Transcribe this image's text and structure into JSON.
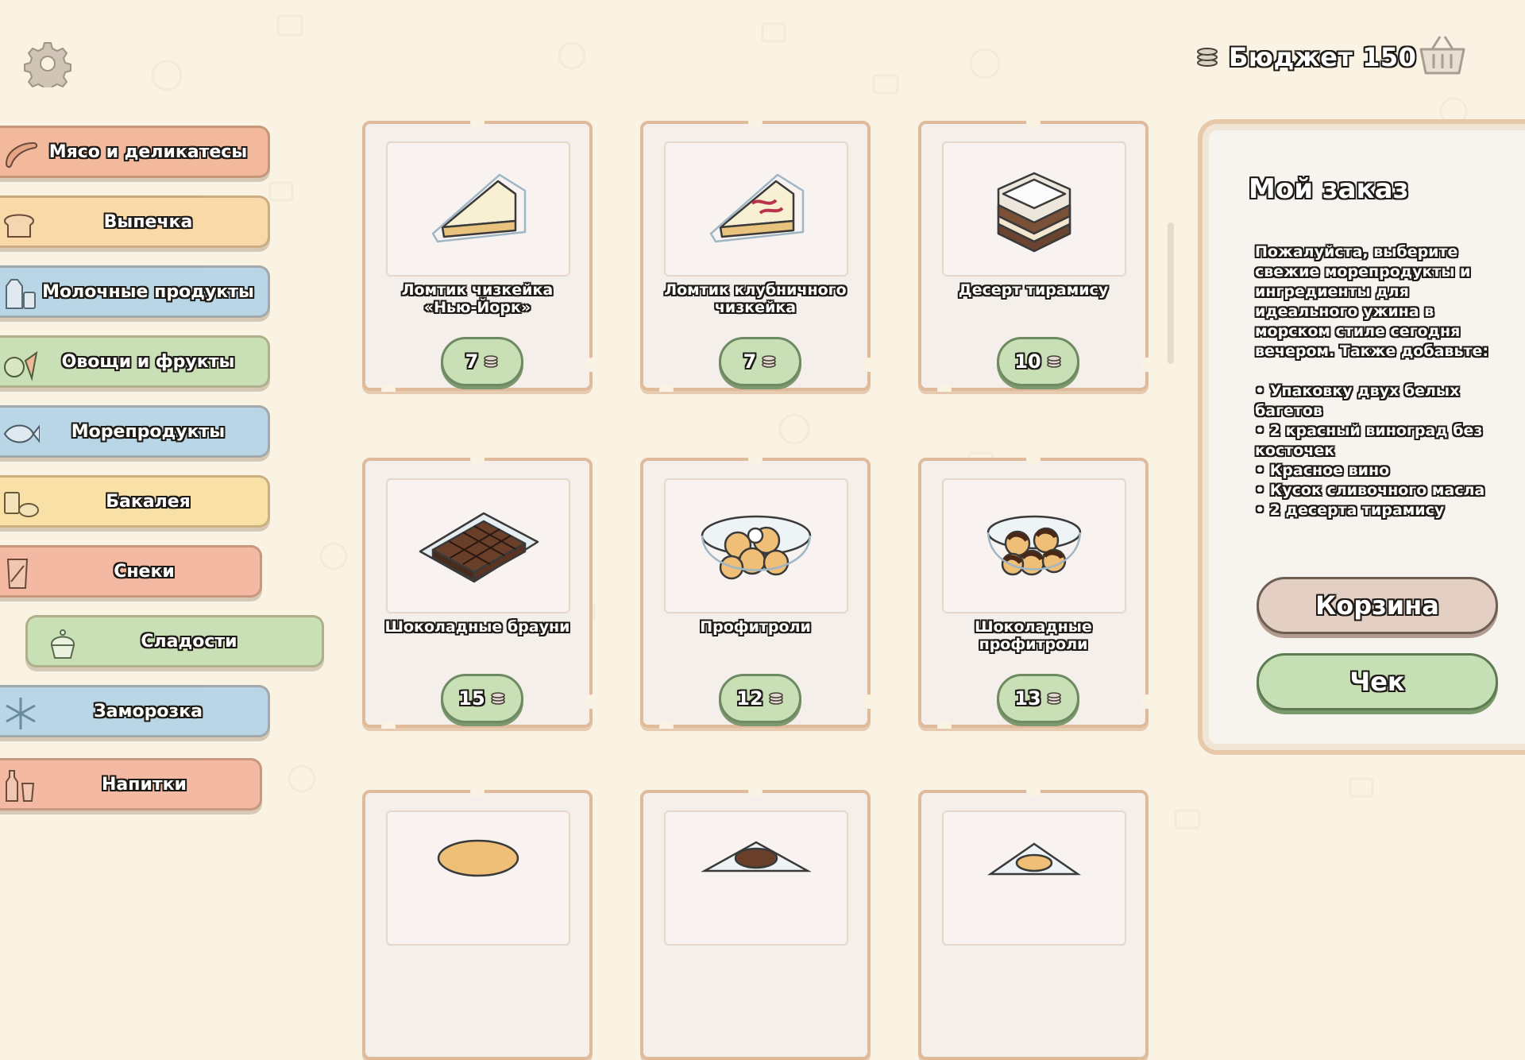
{
  "header": {
    "budget_label": "Бюджет 150",
    "icons": [
      "gear-icon",
      "coins-icon",
      "basket-icon"
    ]
  },
  "categories": [
    {
      "label": "Мясо и деликатесы",
      "color": "#f2b99d",
      "icon": "sausage-icon"
    },
    {
      "label": "Выпечка",
      "color": "#f9d9a8",
      "icon": "bread-icon"
    },
    {
      "label": "Молочные продукты",
      "color": "#b8d6e6",
      "icon": "milk-icon"
    },
    {
      "label": "Овощи и фрукты",
      "color": "#c9dfb6",
      "icon": "apple-carrot-icon"
    },
    {
      "label": "Морепродукты",
      "color": "#b8d6e6",
      "icon": "fish-icon"
    },
    {
      "label": "Бакалея",
      "color": "#f8e0a6",
      "icon": "grocery-icon"
    },
    {
      "label": "Снеки",
      "color": "#f3b9a2",
      "icon": "snack-bag-icon"
    },
    {
      "label": "Сладости",
      "color": "#c9dfb6",
      "icon": "cupcake-icon",
      "active": true
    },
    {
      "label": "Заморозка",
      "color": "#b8d6e6",
      "icon": "snowflake-icon"
    },
    {
      "label": "Напитки",
      "color": "#f3b9a2",
      "icon": "bottles-icon"
    }
  ],
  "products": [
    {
      "name": "Ломтик чизкейка «Нью-Йорк»",
      "price": "7",
      "icon": "cheesecake-icon"
    },
    {
      "name": "Ломтик клубничного чизкейка",
      "price": "7",
      "icon": "strawberry-cheesecake-icon"
    },
    {
      "name": "Десерт тирамису",
      "price": "10",
      "icon": "tiramisu-icon"
    },
    {
      "name": "Шоколадные брауни",
      "price": "15",
      "icon": "brownies-icon"
    },
    {
      "name": "Профитроли",
      "price": "12",
      "icon": "profiteroles-icon"
    },
    {
      "name": "Шоколадные профитроли",
      "price": "13",
      "icon": "chocolate-profiteroles-icon"
    }
  ],
  "order": {
    "title": "Мой заказ",
    "intro": "Пожалуйста, выберите свежие морепродукты и ингредиенты для идеального ужина в морском стиле сегодня вечером. Также добавьте:",
    "items": [
      "• Упаковку двух белых багетов",
      "• 2 красный виноград без косточек",
      "• Красное вино",
      "• Кусок сливочного масла",
      "• 2 десерта тирамису"
    ],
    "cart_button": "Корзина",
    "check_button": "Чек"
  },
  "colors": {
    "background": "#faf3e3",
    "card_border": "#e0bb9b",
    "price_green": "#c9dfb6",
    "cart_button": "#e3cfc3",
    "check_button": "#c7dfb5"
  }
}
